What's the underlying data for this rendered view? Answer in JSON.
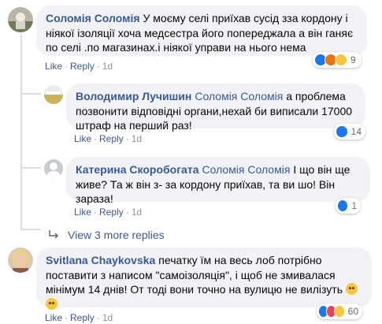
{
  "comments": [
    {
      "author": "Соломія Соломія",
      "text": "У моєму селі приїхав сусід зза кордону і ніякої ізоляції хоча медсестра його попереджала а він ганяє по селі .по магазинах.і ніякої управи на нього нема",
      "like": "Like",
      "reply": "Reply",
      "time": "1d",
      "reactions": [
        "like-icon",
        "angry-icon",
        "sad-icon"
      ],
      "reaction_count": "9"
    },
    {
      "author": "Володимир Лучишин",
      "mention": "Соломія Соломія",
      "text": "а проблема позвонити відповідні органи,нехай би виписали 17000 штраф на перший раз!",
      "like": "Like",
      "reply": "Reply",
      "time": "1d",
      "reactions": [
        "like-icon"
      ],
      "reaction_count": "14"
    },
    {
      "author": "Катерина Скоробогата",
      "mention": "Соломія Соломія",
      "text": "І що він ще живе? Та ж він з- за кордону приїхав, та ви шо! Він зараза!",
      "like": "Like",
      "reply": "Reply",
      "time": "1d",
      "reactions": [
        "like-icon"
      ],
      "reaction_count": "1"
    },
    {
      "author": "Svitlana Chaykovska",
      "text": "печатку їм на весь лоб потрібно поставити з написом \"самоізоляція\", і щоб не змивалася мінімум 14 днів! От тоді вони точно на вулицю не вилізуть",
      "like": "Like",
      "reply": "Reply",
      "time": "1d",
      "reactions": [
        "like-icon",
        "love-icon",
        "haha-icon"
      ],
      "reaction_count": "60"
    }
  ],
  "view_more": "View 3 more replies",
  "colors": {
    "link": "#3b5998",
    "bubble": "#f0f2f5",
    "meta": "#90949c"
  }
}
